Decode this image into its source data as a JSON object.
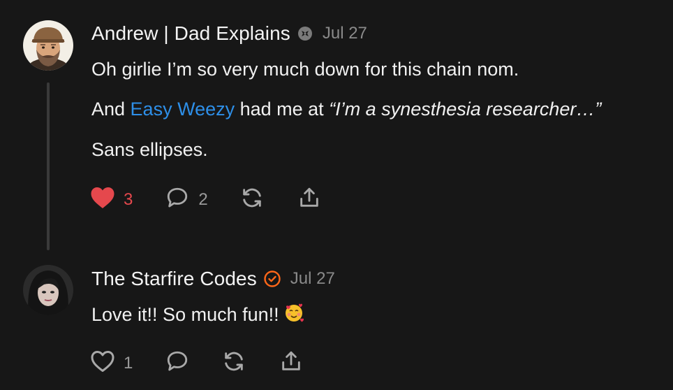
{
  "comments": [
    {
      "author": "Andrew | Dad Explains",
      "date": "Jul 27",
      "badge_icon": "substack-bestseller-badge-icon",
      "avatar": "illustrated-man-with-cap-and-beard",
      "body": {
        "p1": "Oh girlie I’m so very much down for this chain nom.",
        "p2_prefix": "And ",
        "p2_mention": "Easy Weezy",
        "p2_middle": " had me at ",
        "p2_quote": "“I’m a synesthesia researcher…”",
        "p3": "Sans ellipses."
      },
      "likes": "3",
      "liked": true,
      "replies": "2"
    },
    {
      "author": "The Starfire Codes",
      "date": "Jul 27",
      "badge_icon": "verified-check-icon",
      "avatar": "woman-with-dark-hair-photo",
      "body": {
        "p1": "Love it!! So much fun!!"
      },
      "likes": "1",
      "liked": false,
      "emoji": "smiling-face-with-hearts-icon"
    }
  ],
  "colors": {
    "background": "#171717",
    "text": "#f1f1f1",
    "muted": "#8a8a8a",
    "like_active": "#e5484d",
    "mention": "#2e8fe8",
    "verified": "#ff6719",
    "thread_line": "#3a3a3a"
  }
}
